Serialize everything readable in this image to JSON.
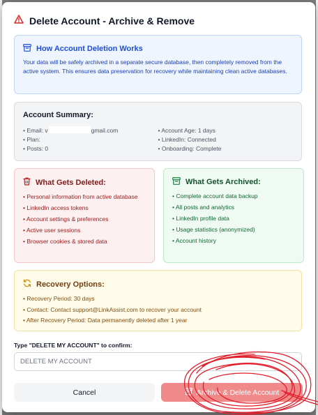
{
  "modal": {
    "title": "Delete Account - Archive & Remove",
    "title_icon": "warning-triangle-icon"
  },
  "info": {
    "heading": "How Account Deletion Works",
    "icon": "archive-box-icon",
    "text": "Your data will be safely archived in a separate secure database, then completely removed from the active system. This ensures data preservation for recovery while maintaining clean active databases."
  },
  "summary": {
    "heading": "Account Summary:",
    "left": [
      {
        "label": "Email:",
        "value_start": "v",
        "value_end": "gmail.com"
      },
      {
        "label": "Plan:",
        "value": ""
      },
      {
        "label": "Posts:",
        "value": "0"
      }
    ],
    "right": [
      {
        "label": "Account Age:",
        "value": "1 days"
      },
      {
        "label": "LinkedIn:",
        "value": "Connected"
      },
      {
        "label": "Onboarding:",
        "value": "Complete"
      }
    ]
  },
  "deleted": {
    "heading": "What Gets Deleted:",
    "icon": "trash-icon",
    "items": [
      "Personal information from active database",
      "LinkedIn access tokens",
      "Account settings & preferences",
      "Active user sessions",
      "Browser cookies & stored data"
    ]
  },
  "archived": {
    "heading": "What Gets Archived:",
    "icon": "archive-box-icon",
    "items": [
      "Complete account data backup",
      "All posts and analytics",
      "LinkedIn profile data",
      "Usage statistics (anonymized)",
      "Account history"
    ]
  },
  "recovery": {
    "heading": "Recovery Options:",
    "icon": "refresh-icon",
    "items": [
      "Recovery Period: 30 days",
      "Contact: Contact support@LinkAssist.com to recover your account",
      "After Recovery Period: Data permanently deleted after 1 year"
    ]
  },
  "confirm": {
    "label": "Type \"DELETE MY ACCOUNT\" to confirm:",
    "placeholder": "DELETE MY ACCOUNT",
    "value": ""
  },
  "buttons": {
    "cancel": "Cancel",
    "danger": "Archive & Delete Account",
    "danger_icon": "archive-icon"
  },
  "colors": {
    "danger": "#f08a8a",
    "annotation": "#e11d2a",
    "info_bg": "#eef5ff",
    "deleted_bg": "#fdf0f0",
    "archived_bg": "#effaf2",
    "recovery_bg": "#fffcea"
  }
}
